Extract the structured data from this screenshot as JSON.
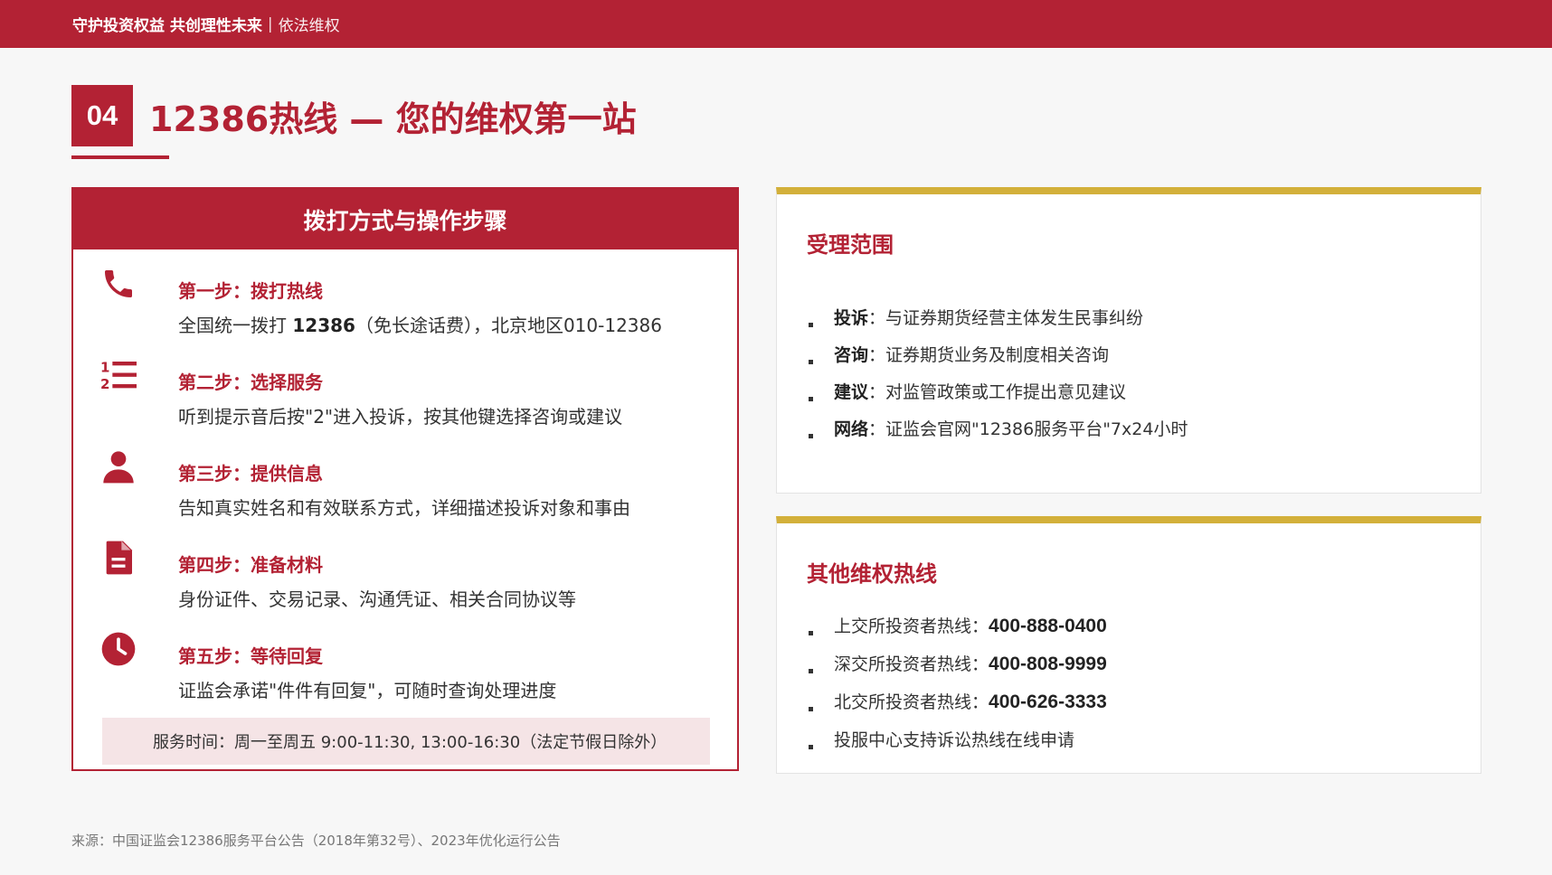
{
  "header": {
    "slogan": "守护投资权益 共创理性未来",
    "separator": "|",
    "section": "依法维权"
  },
  "title": {
    "number": "04",
    "text": "12386热线 — 您的维权第一站"
  },
  "left_panel": {
    "heading": "拨打方式与操作步骤",
    "steps": [
      {
        "icon": "phone-icon",
        "title": "第一步：拨打热线",
        "desc_pre": "全国统一拨打 ",
        "desc_bold": "12386",
        "desc_post": "（免长途话费），北京地区010-12386"
      },
      {
        "icon": "numbered-list-icon",
        "title": "第二步：选择服务",
        "desc": "听到提示音后按\"2\"进入投诉，按其他键选择咨询或建议"
      },
      {
        "icon": "user-icon",
        "title": "第三步：提供信息",
        "desc": "告知真实姓名和有效联系方式，详细描述投诉对象和事由"
      },
      {
        "icon": "document-icon",
        "title": "第四步：准备材料",
        "desc": "身份证件、交易记录、沟通凭证、相关合同协议等"
      },
      {
        "icon": "clock-icon",
        "title": "第五步：等待回复",
        "desc": "证监会承诺\"件件有回复\"，可随时查询处理进度"
      }
    ],
    "service_time": "服务时间：周一至周五 9:00-11:30, 13:00-16:30（法定节假日除外）"
  },
  "scope_card": {
    "title": "受理范围",
    "items": [
      {
        "label": "投诉",
        "text": "：与证券期货经营主体发生民事纠纷"
      },
      {
        "label": "咨询",
        "text": "：证券期货业务及制度相关咨询"
      },
      {
        "label": "建议",
        "text": "：对监管政策或工作提出意见建议"
      },
      {
        "label": "网络",
        "text": "：证监会官网\"12386服务平台\"7x24小时"
      }
    ]
  },
  "hotline_card": {
    "title": "其他维权热线",
    "items": [
      {
        "label": "上交所投资者热线：",
        "number": "400-888-0400"
      },
      {
        "label": "深交所投资者热线：",
        "number": "400-808-9999"
      },
      {
        "label": "北交所投资者热线：",
        "number": "400-626-3333"
      },
      {
        "label": "投服中心支持诉讼热线在线申请",
        "number": ""
      }
    ]
  },
  "footer": {
    "source": "来源：中国证监会12386服务平台公告（2018年第32号）、2023年优化运行公告"
  },
  "colors": {
    "primary": "#b32234",
    "accent": "#d3b03a",
    "highlight_bg": "#f5e4e6"
  }
}
